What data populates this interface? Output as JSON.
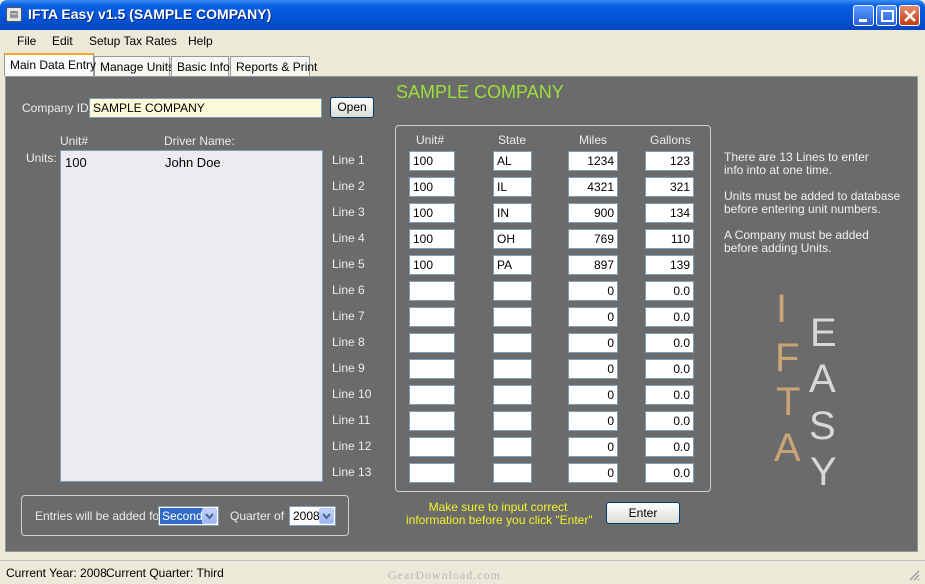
{
  "window": {
    "title": "IFTA Easy  v1.5 (SAMPLE COMPANY)"
  },
  "menu": [
    "File",
    "Edit",
    "Setup Tax Rates",
    "Help"
  ],
  "tabs": [
    "Main Data Entry",
    "Manage Units",
    "Basic Info",
    "Reports & Print"
  ],
  "company": {
    "label": "Company ID:",
    "value": "SAMPLE COMPANY",
    "open_label": "Open",
    "heading": "SAMPLE COMPANY"
  },
  "units": {
    "label": "Units:",
    "col_unit": "Unit#",
    "col_driver": "Driver Name:",
    "rows": [
      {
        "unit": "100",
        "driver": "John Doe"
      }
    ]
  },
  "grid": {
    "headers": {
      "unit": "Unit#",
      "state": "State",
      "miles": "Miles",
      "gallons": "Gallons"
    },
    "lines": [
      {
        "label": "Line 1",
        "unit": "100",
        "state": "AL",
        "miles": "1234",
        "gallons": "123"
      },
      {
        "label": "Line 2",
        "unit": "100",
        "state": "IL",
        "miles": "4321",
        "gallons": "321"
      },
      {
        "label": "Line 3",
        "unit": "100",
        "state": "IN",
        "miles": "900",
        "gallons": "134"
      },
      {
        "label": "Line 4",
        "unit": "100",
        "state": "OH",
        "miles": "769",
        "gallons": "110"
      },
      {
        "label": "Line 5",
        "unit": "100",
        "state": "PA",
        "miles": "897",
        "gallons": "139"
      },
      {
        "label": "Line 6",
        "unit": "",
        "state": "",
        "miles": "0",
        "gallons": "0.0"
      },
      {
        "label": "Line 7",
        "unit": "",
        "state": "",
        "miles": "0",
        "gallons": "0.0"
      },
      {
        "label": "Line 8",
        "unit": "",
        "state": "",
        "miles": "0",
        "gallons": "0.0"
      },
      {
        "label": "Line 9",
        "unit": "",
        "state": "",
        "miles": "0",
        "gallons": "0.0"
      },
      {
        "label": "Line 10",
        "unit": "",
        "state": "",
        "miles": "0",
        "gallons": "0.0"
      },
      {
        "label": "Line 11",
        "unit": "",
        "state": "",
        "miles": "0",
        "gallons": "0.0"
      },
      {
        "label": "Line 12",
        "unit": "",
        "state": "",
        "miles": "0",
        "gallons": "0.0"
      },
      {
        "label": "Line 13",
        "unit": "",
        "state": "",
        "miles": "0",
        "gallons": "0.0"
      }
    ]
  },
  "info": {
    "line1a": "There are 13 Lines to enter",
    "line1b": "info into at one time.",
    "line2a": "Units must be added to database",
    "line2b": "before entering unit numbers.",
    "line3a": "A Company must be added",
    "line3b": "before adding Units."
  },
  "logo": {
    "left_letters": [
      "I",
      "F",
      "T",
      "A"
    ],
    "right_letters": [
      "E",
      "A",
      "S",
      "Y"
    ]
  },
  "entries": {
    "label": "Entries will be added for",
    "quarter": "Second",
    "quarter_of": "Quarter of",
    "year": "2008"
  },
  "notice": {
    "line1": "Make sure to input correct",
    "line2": "information before you click \"Enter\""
  },
  "enter_label": "Enter",
  "status": {
    "year": "Current Year: 2008",
    "quarter": "Current Quarter: Third",
    "watermark": "GearDownload.com"
  },
  "colors": {
    "panel": "#6b6b6b",
    "heading": "#9be03a",
    "notice": "#f2f22c",
    "logo_left": "#c9a477",
    "logo_right": "#d8d8d8"
  }
}
